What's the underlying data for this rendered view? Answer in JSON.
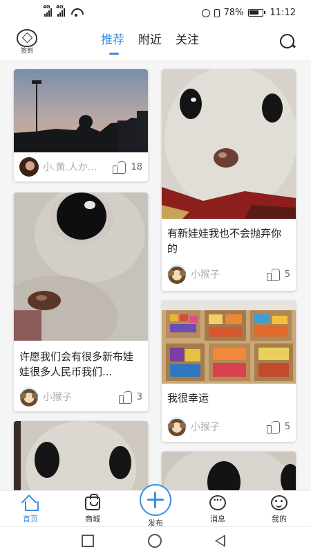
{
  "status": {
    "network1": "4G",
    "network2": "4G",
    "battery": "78%",
    "time": "11:12"
  },
  "header": {
    "signin_label": "签到",
    "tabs": [
      {
        "label": "推荐"
      },
      {
        "label": "附近"
      },
      {
        "label": "关注"
      }
    ]
  },
  "feed": {
    "left": [
      {
        "caption": "",
        "user": "小.黄.人か...",
        "likes": "18",
        "image": "sunset-street-photo"
      },
      {
        "caption": "许愿我们会有很多新布娃娃很多人民币我们...",
        "user": "小猴子",
        "likes": "3",
        "image": "plush-toy-closeup"
      },
      {
        "caption": "",
        "user": "",
        "likes": "",
        "image": "plush-toy-photo"
      }
    ],
    "right": [
      {
        "caption": "有新娃娃我也不会抛弃你的",
        "user": "小猴子",
        "likes": "5",
        "image": "plush-toy-photo"
      },
      {
        "caption": "我很幸运",
        "user": "小猴子",
        "likes": "5",
        "image": "snack-boxes-photo"
      },
      {
        "caption": "",
        "user": "",
        "likes": "",
        "image": "plush-toy-photo"
      }
    ]
  },
  "tabbar": {
    "items": [
      {
        "label": "首页",
        "icon": "home-icon",
        "active": true
      },
      {
        "label": "商城",
        "icon": "shopping-bag-icon"
      },
      {
        "label": "发布",
        "icon": "plus-icon"
      },
      {
        "label": "消息",
        "icon": "chat-bubble-icon"
      },
      {
        "label": "我的",
        "icon": "smiley-face-icon"
      }
    ]
  },
  "colors": {
    "accent": "#3a8fe0",
    "muted_text": "#aaaaaa",
    "background": "#f5f5f5"
  }
}
